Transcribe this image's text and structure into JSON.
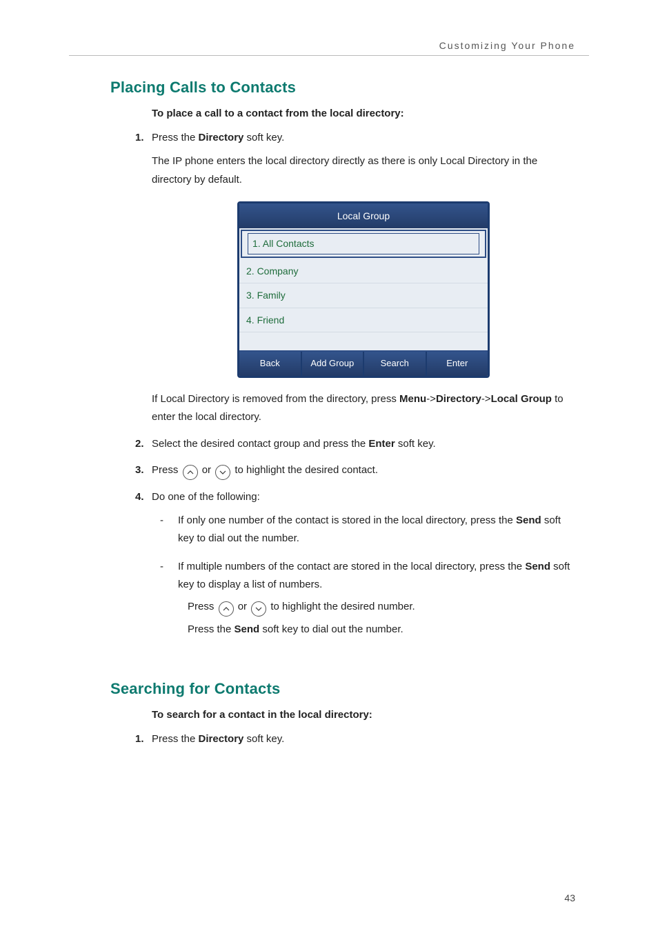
{
  "running_head": "Customizing Your Phone",
  "page_number": "43",
  "section1": {
    "title": "Placing Calls to Contacts",
    "subhead": "To place a call to a contact from the local directory:",
    "step1": {
      "num": "1.",
      "pre": "Press the ",
      "key": "Directory",
      "post": " soft key.",
      "para": "The IP phone enters the local directory directly as there is only Local Directory in the directory by default."
    },
    "step1b": {
      "pre": "If Local Directory is removed from the directory, press ",
      "menu": "Menu",
      "arrow1": "->",
      "dir": "Directory",
      "arrow2": "->",
      "lg1": "Local",
      "lg2": "Group",
      "post": " to enter the local directory."
    },
    "step2": {
      "num": "2.",
      "pre": "Select the desired contact group and press the ",
      "key": "Enter",
      "post": " soft key."
    },
    "step3": {
      "num": "3.",
      "pre": "Press ",
      "mid": " or ",
      "post": " to highlight the desired contact."
    },
    "step4": {
      "num": "4.",
      "text": "Do one of the following:",
      "bullet1": {
        "pre": "If only one number of the contact is stored in the local directory, press the ",
        "key": "Send",
        "post": " soft key to dial out the number."
      },
      "bullet2": {
        "pre": "If multiple numbers of the contact are stored in the local directory, press the ",
        "key": "Send",
        "post": " soft key to display a list of numbers.",
        "l2pre": "Press ",
        "l2mid": " or ",
        "l2post": " to highlight the desired number.",
        "l3pre": "Press the ",
        "l3key": "Send",
        "l3post": " soft key to dial out the number."
      }
    }
  },
  "phone": {
    "title": "Local Group",
    "rows": [
      "1. All Contacts",
      "2. Company",
      "3. Family",
      "4. Friend"
    ],
    "softkeys": [
      "Back",
      "Add Group",
      "Search",
      "Enter"
    ]
  },
  "section2": {
    "title": "Searching for Contacts",
    "subhead": "To search for a contact in the local directory:",
    "step1": {
      "num": "1.",
      "pre": "Press the ",
      "key": "Directory",
      "post": " soft key."
    }
  }
}
